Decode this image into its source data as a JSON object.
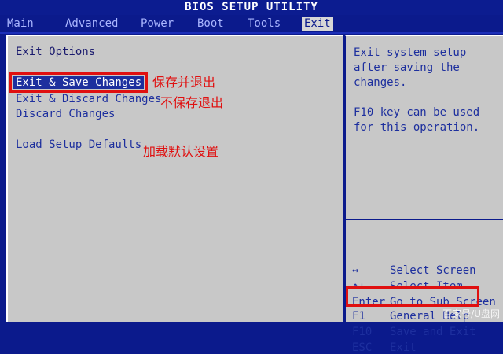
{
  "title": "BIOS SETUP UTILITY",
  "menu": [
    "Main",
    "Advanced",
    "Power",
    "Boot",
    "Tools",
    "Exit"
  ],
  "section_title": "Exit Options",
  "options": [
    {
      "label": "Exit & Save Changes",
      "note": "保存并退出"
    },
    {
      "label": "Exit & Discard Changes",
      "note": "不保存退出"
    },
    {
      "label": "Discard Changes",
      "note": ""
    },
    {
      "label": "Load Setup Defaults",
      "note": "加载默认设置"
    }
  ],
  "help": {
    "description": "Exit system setup after saving the changes.",
    "f10_note": "F10 key can be used for this operation."
  },
  "legend": [
    {
      "key": "↔",
      "action": "Select Screen"
    },
    {
      "key": "↑↓",
      "action": "Select Item"
    },
    {
      "key": "Enter",
      "action": "Go to Sub Screen"
    },
    {
      "key": "F1",
      "action": "General Help"
    },
    {
      "key": "F10",
      "action": "Save and Exit"
    },
    {
      "key": "ESC",
      "action": "Exit"
    }
  ],
  "watermark": "百家号/U盘网",
  "colors": {
    "bios_blue": "#0b1a8c",
    "panel_gray": "#c8c8c8",
    "annotation_red": "#e01010"
  }
}
